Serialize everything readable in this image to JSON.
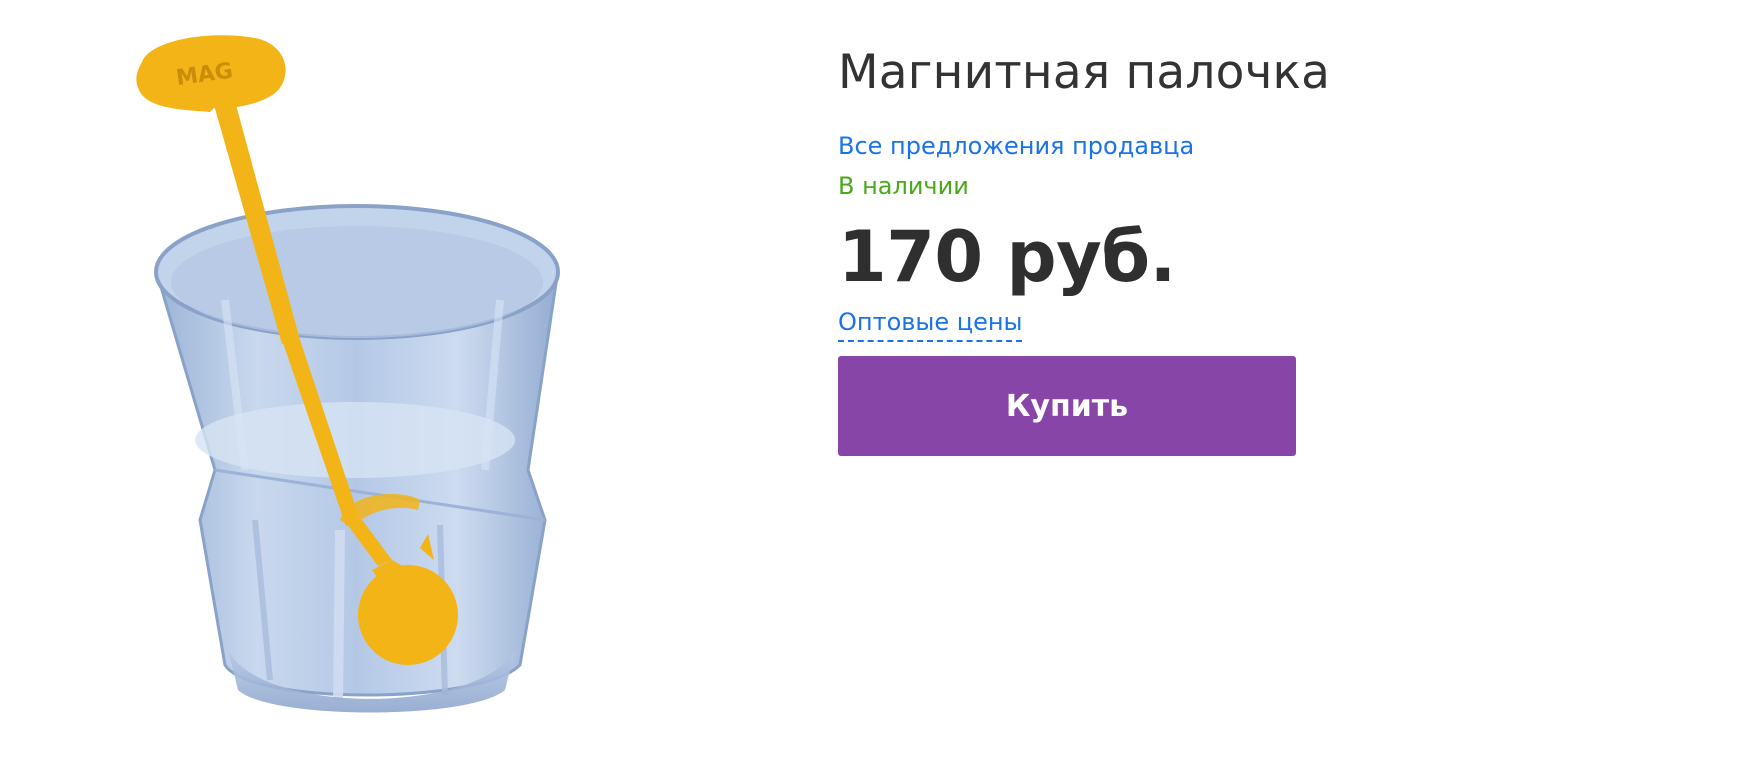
{
  "product": {
    "title": "Магнитная палочка",
    "seller_link": "Все предложения продавца",
    "stock_status": "В наличии",
    "price": "170 руб.",
    "wholesale_link": "Оптовые цены",
    "buy_label": "Купить",
    "image": {
      "name": "magnetic-stirrer-in-glass",
      "stick_text": "MAG"
    }
  },
  "colors": {
    "title": "#333333",
    "link": "#1a73e8",
    "in_stock": "#4aa81b",
    "price": "#2f2f2f",
    "buy_button": "#8745a8",
    "stick": "#f2b417"
  }
}
